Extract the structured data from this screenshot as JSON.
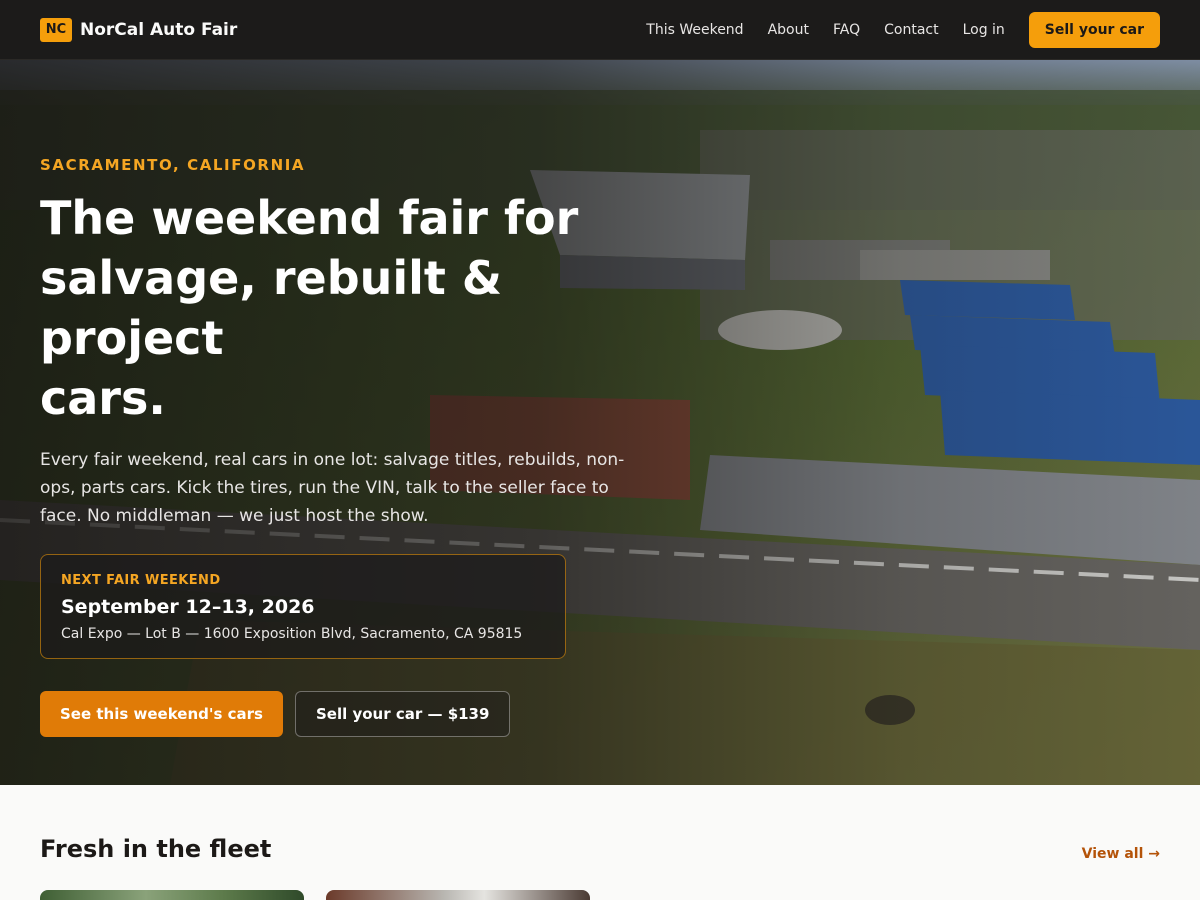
{
  "header": {
    "logo_badge": "NC",
    "brand_name": "NorCal Auto Fair",
    "nav": [
      "This Weekend",
      "About",
      "FAQ",
      "Contact",
      "Log in"
    ],
    "cta": "Sell your car"
  },
  "hero": {
    "eyebrow": "SACRAMENTO, CALIFORNIA",
    "title_line1": "The weekend fair for",
    "title_line2": "salvage, rebuilt & project",
    "title_line3": "cars.",
    "description": "Every fair weekend, real cars in one lot: salvage titles, rebuilds, non-ops, parts cars. Kick the tires, run the VIN, talk to the seller face to face. No middleman — we just host the show.",
    "event": {
      "label": "NEXT FAIR WEEKEND",
      "date": "September 12–13, 2026",
      "location": "Cal Expo — Lot B — 1600 Exposition Blvd, Sacramento, CA 95815"
    },
    "primary_button": "See this weekend's cars",
    "secondary_button": "Sell your car — $139"
  },
  "fleet": {
    "title": "Fresh in the fleet",
    "view_all": "View all →"
  },
  "colors": {
    "accent": "#f59e0b",
    "accent_dark": "#e07b07",
    "header_bg": "#1c1b1a",
    "link": "#b45309"
  },
  "icons": [
    "arrow-right-icon"
  ]
}
